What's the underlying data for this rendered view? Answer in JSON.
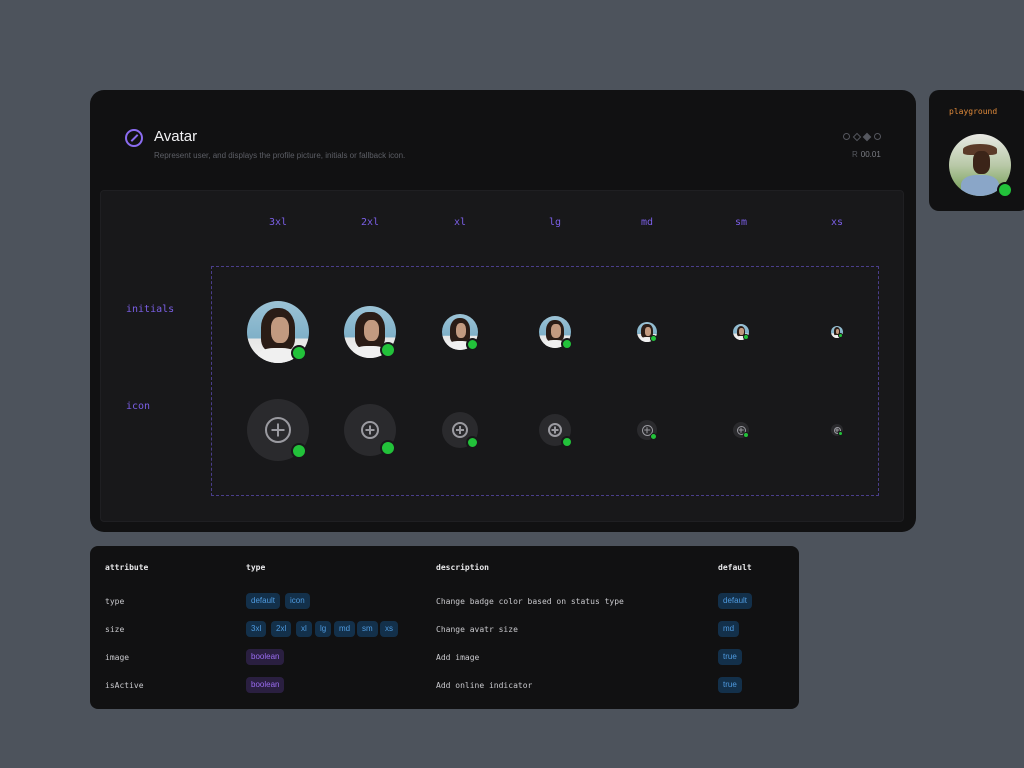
{
  "header": {
    "title": "Avatar",
    "subtitle": "Represent user, and displays the profile picture, initials or fallback icon.",
    "version_prefix": "R",
    "version": "00.01",
    "icon": "avatar-component-icon"
  },
  "sizes": [
    "3xl",
    "2xl",
    "xl",
    "lg",
    "md",
    "sm",
    "xs"
  ],
  "rows": {
    "initials_label": "initials",
    "icon_label": "icon"
  },
  "playground": {
    "label": "playground"
  },
  "table": {
    "headers": {
      "attribute": "attribute",
      "type": "type",
      "description": "description",
      "default": "default"
    },
    "rows": [
      {
        "attribute": "type",
        "types": [
          "default",
          "icon"
        ],
        "type_style": "blue",
        "description": "Change badge color based on status type",
        "default": "default"
      },
      {
        "attribute": "size",
        "types": [
          "3xl",
          "2xl",
          "xl",
          "lg",
          "md",
          "sm",
          "xs"
        ],
        "type_style": "blue",
        "description": "Change avatr size",
        "default": "md"
      },
      {
        "attribute": "image",
        "types": [
          "boolean"
        ],
        "type_style": "purple",
        "description": "Add image",
        "default": "true"
      },
      {
        "attribute": "isActive",
        "types": [
          "boolean"
        ],
        "type_style": "purple",
        "description": "Add online indicator",
        "default": "true"
      }
    ]
  },
  "colors": {
    "accent": "#7b5fe6",
    "status_online": "#22c23a",
    "playground_label": "#e08a3a"
  }
}
